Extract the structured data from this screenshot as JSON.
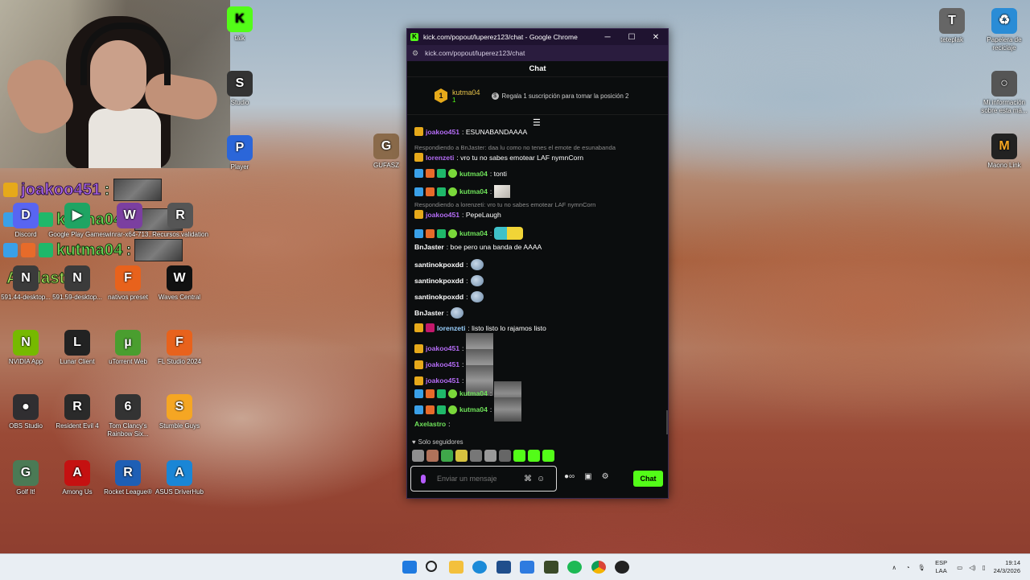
{
  "webcam": {
    "label": "webcam"
  },
  "overlay": [
    {
      "name": "joakoo451",
      "suffix": ":",
      "color": "#b46cf5"
    },
    {
      "name": "kutma04",
      "suffix": ":",
      "color": "#6fe35a"
    },
    {
      "name": "kutma04",
      "suffix": " :",
      "color": "#6fe35a"
    },
    {
      "name": "Axelastro",
      "suffix": ":",
      "color": "#a9e05a"
    }
  ],
  "desktop_icons": [
    {
      "label": "Discord",
      "color": "#5865f2",
      "glyph": "D"
    },
    {
      "label": "Google Play Games",
      "color": "#1fa463",
      "glyph": "▶"
    },
    {
      "label": "winrar-x64-713...",
      "color": "#7b3fa0",
      "glyph": "W"
    },
    {
      "label": "Recursos.validation",
      "color": "#555",
      "glyph": "R"
    },
    {
      "label": "591.44-desktop...",
      "color": "#3b3b3b",
      "glyph": "N"
    },
    {
      "label": "591.59-desktop...",
      "color": "#3b3b3b",
      "glyph": "N"
    },
    {
      "label": "nativos preset",
      "color": "#e8621c",
      "glyph": "F"
    },
    {
      "label": "Waves Central",
      "color": "#111",
      "glyph": "W"
    },
    {
      "label": "NVIDIA App",
      "color": "#76b900",
      "glyph": "N"
    },
    {
      "label": "Lunar Client",
      "color": "#222",
      "glyph": "L"
    },
    {
      "label": "uTorrent Web",
      "color": "#4a9e2f",
      "glyph": "µ"
    },
    {
      "label": "FL Studio 2024",
      "color": "#e8621c",
      "glyph": "F"
    },
    {
      "label": "OBS Studio",
      "color": "#302e31",
      "glyph": "●"
    },
    {
      "label": "Resident Evil 4",
      "color": "#2a2a2a",
      "glyph": "R"
    },
    {
      "label": "Tom Clancy's Rainbow Six...",
      "color": "#333",
      "glyph": "6"
    },
    {
      "label": "Stumble Guys",
      "color": "#f5a623",
      "glyph": "S"
    },
    {
      "label": "Golf It!",
      "color": "#4b7a55",
      "glyph": "G"
    },
    {
      "label": "Among Us",
      "color": "#c51111",
      "glyph": "A"
    },
    {
      "label": "Rocket League®",
      "color": "#1e5fb5",
      "glyph": "R"
    },
    {
      "label": "ASUS DriverHub",
      "color": "#1a86d6",
      "glyph": "A"
    },
    {
      "label": "Studio",
      "color": "#333",
      "glyph": "S"
    },
    {
      "label": "Player",
      "color": "#2b66d9",
      "glyph": "P"
    },
    {
      "label": "GUFASZ",
      "color": "#8a6a4a",
      "glyph": "G"
    },
    {
      "label": "talk",
      "color": "#53fc18",
      "glyph": "K"
    },
    {
      "label": "teteplak",
      "color": "#666",
      "glyph": "T"
    },
    {
      "label": "Papelera de reciclaje",
      "color": "#2a8cd6",
      "glyph": "♻"
    },
    {
      "label": "Mi información sobre esta má...",
      "color": "#555",
      "glyph": "○"
    },
    {
      "label": "Maono Link",
      "color": "#222",
      "glyph": "M"
    }
  ],
  "window": {
    "title": "kick.com/popout/luperez123/chat - Google Chrome",
    "url": "kick.com/popout/luperez123/chat",
    "minimize": "─",
    "maximize": "☐",
    "close": "✕",
    "chat_header": "Chat",
    "pinned_user": "kutma04",
    "pinned_count": "1",
    "pinned_rank": "1",
    "promo_text": "Regala 1 suscripción para tomar la posición 2",
    "filter_icon": "☰"
  },
  "messages": [
    {
      "user": "joakoo451",
      "color": "#b46cf5",
      "text": ": ESUNABANDAAAA",
      "badges": [
        "crown"
      ]
    },
    {
      "reply": "Respondiendo a BnJaster: daa lu como no tenes el emote de esunabanda"
    },
    {
      "user": "lorenzeti",
      "color": "#b46cf5",
      "text": ": vro tu no sabes emotear LAF nymnCorn",
      "badges": [
        "crown"
      ]
    },
    {
      "user": "kutma04",
      "color": "#6fe35a",
      "text": ": tonti",
      "badges": [
        "blue",
        "org",
        "grn",
        "lime"
      ]
    },
    {
      "user": "kutma04",
      "color": "#6fe35a",
      "text": ":",
      "badges": [
        "blue",
        "org",
        "grn",
        "lime"
      ],
      "emote": "cat"
    },
    {
      "reply": "Respondiendo a lorenzeti: vro tu no sabes emotear LAF nymnCorn"
    },
    {
      "user": "joakoo451",
      "color": "#b46cf5",
      "text": ": PepeLaugh",
      "badges": [
        "crown"
      ]
    },
    {
      "user": "kutma04",
      "color": "#6fe35a",
      "text": ":",
      "badges": [
        "blue",
        "org",
        "grn",
        "lime"
      ],
      "emote": "duo"
    },
    {
      "user": "BnJaster",
      "color": "#ffffff",
      "text": ": boe pero una banda de AAAA",
      "badges": []
    },
    {
      "user": "santinokpoxdd",
      "color": "#ffffff",
      "text": ":",
      "badges": [],
      "emote": "ball"
    },
    {
      "user": "santinokpoxdd",
      "color": "#ffffff",
      "text": ":",
      "badges": [],
      "emote": "ball"
    },
    {
      "user": "santinokpoxdd",
      "color": "#ffffff",
      "text": ":",
      "badges": [],
      "emote": "ball"
    },
    {
      "user": "BnJaster",
      "color": "#ffffff",
      "text": ":",
      "badges": [],
      "emote": "ball"
    },
    {
      "user": "lorenzeti",
      "color": "#9ad1ff",
      "text": ": listo listo lo rajamos listo",
      "badges": [
        "crown",
        "pink"
      ]
    },
    {
      "user": "joakoo451",
      "color": "#b46cf5",
      "text": ":",
      "badges": [
        "crown"
      ],
      "emote": "vid2"
    },
    {
      "user": "joakoo451",
      "color": "#b46cf5",
      "text": ":",
      "badges": [
        "crown"
      ],
      "emote": "vid2"
    },
    {
      "user": "joakoo451",
      "color": "#b46cf5",
      "text": ":",
      "badges": [
        "crown"
      ],
      "emote": "vid2"
    },
    {
      "user": "kutma04",
      "color": "#6fe35a",
      "text": ":",
      "badges": [
        "blue",
        "org",
        "grn",
        "lime"
      ],
      "emote": "vid"
    },
    {
      "user": "kutma04",
      "color": "#6fe35a",
      "text": ":",
      "badges": [
        "blue",
        "org",
        "grn",
        "lime"
      ],
      "emote": "vid"
    },
    {
      "user": "Axelastro",
      "color": "#6fe35a",
      "text": ":",
      "badges": []
    }
  ],
  "followers_label": "Solo seguidores",
  "input": {
    "placeholder": "Enviar un mensaje",
    "send_label": "Chat"
  },
  "tray": {
    "lang1": "ESP",
    "lang2": "LAA",
    "time": "19:14",
    "date": "24/3/2026"
  }
}
